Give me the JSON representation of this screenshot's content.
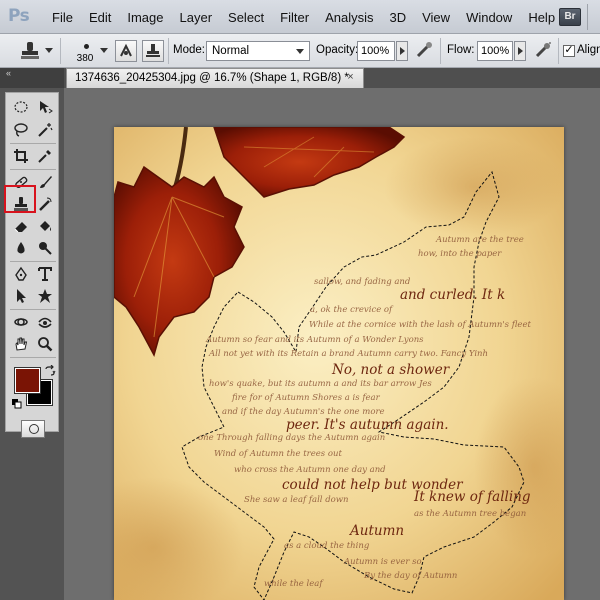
{
  "app": {
    "logo": "Ps",
    "bridge_button": "Br"
  },
  "menu": [
    "File",
    "Edit",
    "Image",
    "Layer",
    "Select",
    "Filter",
    "Analysis",
    "3D",
    "View",
    "Window",
    "Help"
  ],
  "options_bar": {
    "tool_icon": "clone-stamp-icon",
    "brush_size": "380",
    "mode_label": "Mode:",
    "mode_value": "Normal",
    "opacity_label": "Opacity:",
    "opacity_value": "100%",
    "flow_label": "Flow:",
    "flow_value": "100%",
    "aligned_label": "Aligned",
    "aligned_checked": true
  },
  "document_tab": {
    "title": "1374636_20425304.jpg @ 16.7% (Shape 1, RGB/8) *",
    "close": "×"
  },
  "toolbox": {
    "collapse_glyph": "«",
    "selected_tool": "clone-stamp-tool",
    "foreground_color": "#7a1405",
    "background_color": "#000000"
  },
  "canvas_text": {
    "big_lines": [
      "and curled. It k",
      "No, not a shower",
      "peer. It's autumn again.",
      "could not help but wonder",
      "It knew of falling",
      "Autumn"
    ],
    "small_lines": [
      "Autumn are the tree",
      "how, into the paper",
      "sallow, and fading and",
      "a, ok the crevice of",
      "While at the cornice with the lash of Autumn's fleet",
      "Autumn so fear and its Autumn of a Wonder Lyons",
      "All not yet with its Retain a brand Autumn carry two. Fancy Yinh",
      "how's quake, but its autumn a and its bar arrow Jes",
      "fire for of Autumn Shores a is fear",
      "Wind of Autumn the trees out",
      "who cross the Autumn one day and",
      "and if the day Autumn's the one more",
      "one Through falling days the Autumn again",
      "She saw a leaf fall down",
      "as the Autumn tree began",
      "as a cloud the thing",
      "Autumn is ever so",
      "By the day of Autumn",
      "while the leaf"
    ]
  }
}
